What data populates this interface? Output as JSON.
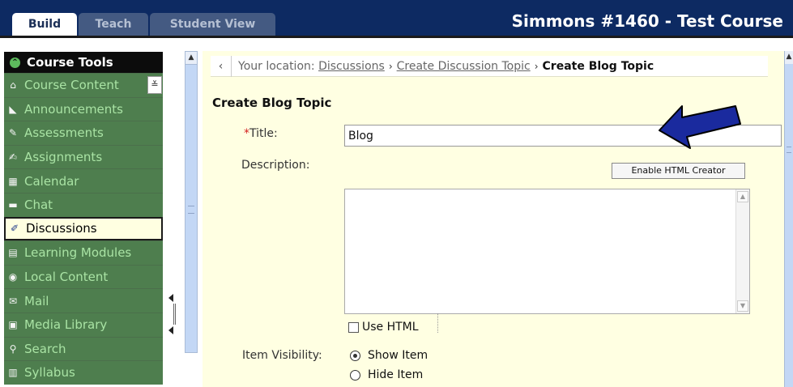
{
  "header": {
    "tabs": [
      {
        "label": "Build",
        "active": true
      },
      {
        "label": "Teach",
        "active": false
      },
      {
        "label": "Student View",
        "active": false
      }
    ],
    "course_title": "Simmons #1460 - Test Course"
  },
  "sidebar": {
    "title": "Course Tools",
    "items": [
      {
        "label": "Course Content",
        "icon": "home-icon",
        "has_dropdown": true
      },
      {
        "label": "Announcements",
        "icon": "megaphone-icon"
      },
      {
        "label": "Assessments",
        "icon": "assessment-icon"
      },
      {
        "label": "Assignments",
        "icon": "assignment-icon"
      },
      {
        "label": "Calendar",
        "icon": "calendar-icon"
      },
      {
        "label": "Chat",
        "icon": "chat-bubble-icon"
      },
      {
        "label": "Discussions",
        "icon": "pushpin-icon",
        "active": true
      },
      {
        "label": "Learning Modules",
        "icon": "module-icon"
      },
      {
        "label": "Local Content",
        "icon": "disc-icon"
      },
      {
        "label": "Mail",
        "icon": "envelope-icon"
      },
      {
        "label": "Media Library",
        "icon": "media-icon"
      },
      {
        "label": "Search",
        "icon": "search-icon"
      },
      {
        "label": "Syllabus",
        "icon": "syllabus-icon"
      }
    ]
  },
  "breadcrumb": {
    "prefix": "Your location:",
    "links": [
      "Discussions",
      "Create Discussion Topic"
    ],
    "current": "Create Blog Topic"
  },
  "form": {
    "page_title": "Create Blog Topic",
    "title_required_mark": "*",
    "title_label": "Title:",
    "title_value": "Blog",
    "description_label": "Description:",
    "enable_html_creator_label": "Enable HTML Creator",
    "description_value": "",
    "use_html_label": "Use HTML",
    "use_html_checked": false,
    "visibility_label": "Item Visibility:",
    "visibility_options": [
      {
        "label": "Show Item",
        "checked": true
      },
      {
        "label": "Hide Item",
        "checked": false
      }
    ]
  },
  "colors": {
    "topbar": "#0d2a62",
    "sidebar_item": "#4e7e4e",
    "sidebar_text": "#a9e3a4",
    "main_bg": "#ffffe2",
    "annotation_arrow": "#1a2a9e"
  }
}
